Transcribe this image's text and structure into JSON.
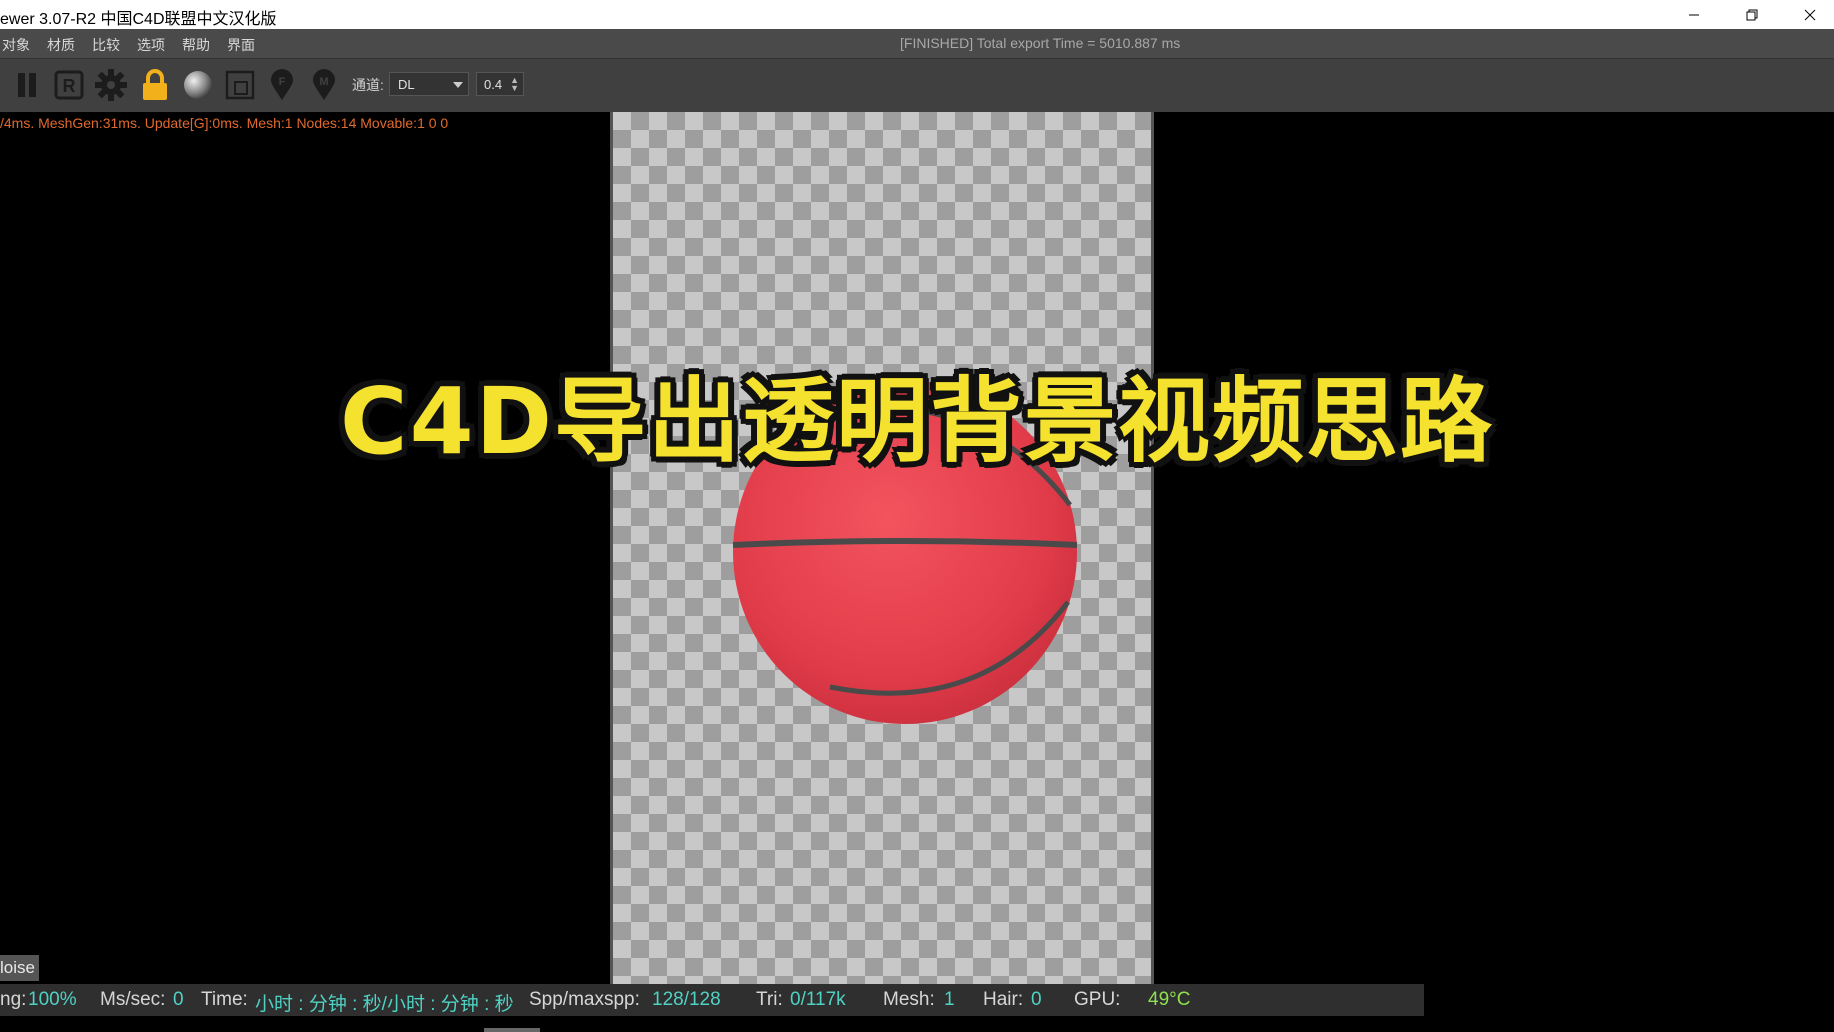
{
  "window": {
    "title": "ewer 3.07-R2 中国C4D联盟中文汉化版"
  },
  "menu": {
    "items": [
      "对象",
      "材质",
      "比较",
      "选项",
      "帮助",
      "界面"
    ],
    "status": "[FINISHED] Total export Time = 5010.887 ms"
  },
  "toolbar": {
    "channel_label": "通道:",
    "channel_value": "DL",
    "number_value": "0.4",
    "icons": [
      "pause-icon",
      "r-icon",
      "gear-icon",
      "lock-icon",
      "sphere-icon",
      "region-icon",
      "focus-pin-icon",
      "material-pin-icon"
    ]
  },
  "viewport": {
    "stats_line": "/4ms. MeshGen:31ms. Update[G]:0ms. Mesh:1 Nodes:14 Movable:1  0 0",
    "headline": "C4D导出透明背景视频思路",
    "denoise_tab": "loise"
  },
  "statusbar": {
    "rendering_label": "ng:",
    "rendering_value": "100%",
    "mssec_label": "Ms/sec:",
    "mssec_value": "0",
    "time_label": "Time:",
    "time_value": "小时 : 分钟 : 秒/小时 : 分钟 : 秒",
    "spp_label": "Spp/maxspp:",
    "spp_value": "128/128",
    "tri_label": "Tri:",
    "tri_value": "0/117k",
    "mesh_label": "Mesh:",
    "mesh_value": "1",
    "hair_label": "Hair:",
    "hair_value": "0",
    "gpu_label": "GPU:",
    "gpu_value": "49°C"
  },
  "colors": {
    "headline": "#f5e22e",
    "stats": "#e06a2e",
    "value_cyan": "#4fd2c4",
    "value_green": "#8fe050",
    "ball": "#e8424e"
  }
}
